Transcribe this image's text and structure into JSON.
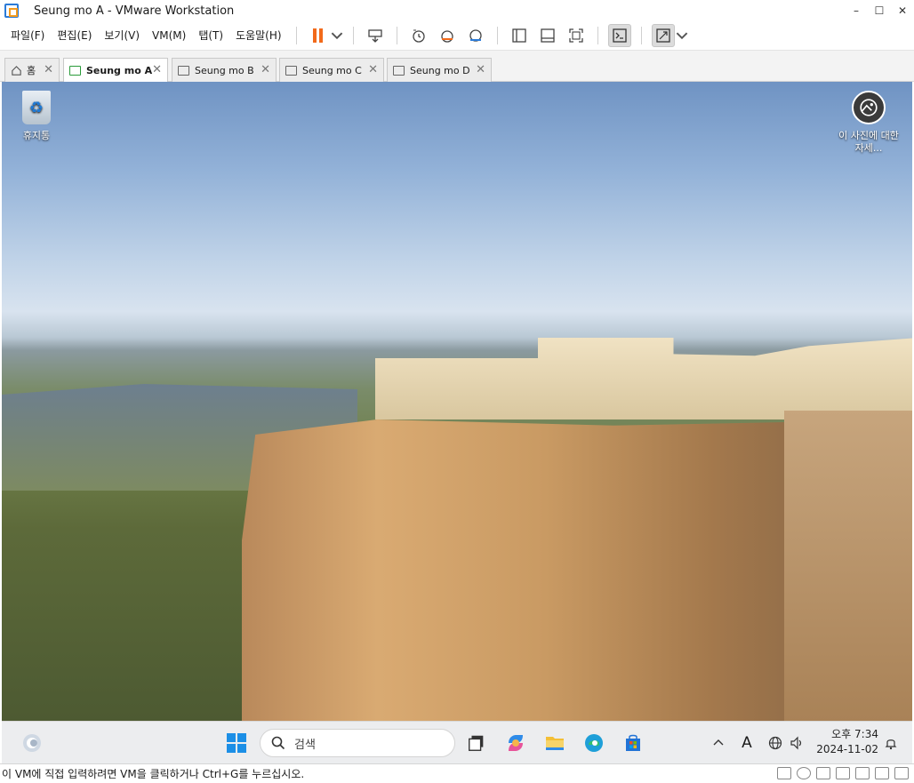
{
  "window": {
    "title": "Seung mo A - VMware Workstation",
    "minimize": "–",
    "maximize": "☐",
    "close": "✕"
  },
  "menu": [
    "파일(F)",
    "편집(E)",
    "보기(V)",
    "VM(M)",
    "탭(T)",
    "도움말(H)"
  ],
  "toolbar_icons": [
    "pause-icon",
    "dropdown-icon",
    "send-ctrl-alt-del-icon",
    "snapshot-take-icon",
    "snapshot-revert-icon",
    "snapshot-manager-icon",
    "show-library-icon",
    "thumbnail-bar-icon",
    "full-screen-icon",
    "console-view-icon",
    "unity-view-icon",
    "dropdown-icon"
  ],
  "tabs": [
    {
      "label": "홈",
      "icon": "home-icon",
      "active": false
    },
    {
      "label": "Seung mo A",
      "icon": "vm-running-icon",
      "active": true
    },
    {
      "label": "Seung mo B",
      "icon": "vm-icon",
      "active": false
    },
    {
      "label": "Seung mo C",
      "icon": "vm-icon",
      "active": false
    },
    {
      "label": "Seung mo D",
      "icon": "vm-icon",
      "active": false
    }
  ],
  "desktop": {
    "recycle_bin": "휴지통",
    "photo_info": "이 사진에 대한 자세..."
  },
  "taskbar": {
    "search_placeholder": "검색",
    "time": "오후 7:34",
    "date": "2024-11-02",
    "ime": "A"
  },
  "statusbar": {
    "message": "이 VM에 직접 입력하려면 VM을 클릭하거나 Ctrl+G를 누르십시오."
  }
}
